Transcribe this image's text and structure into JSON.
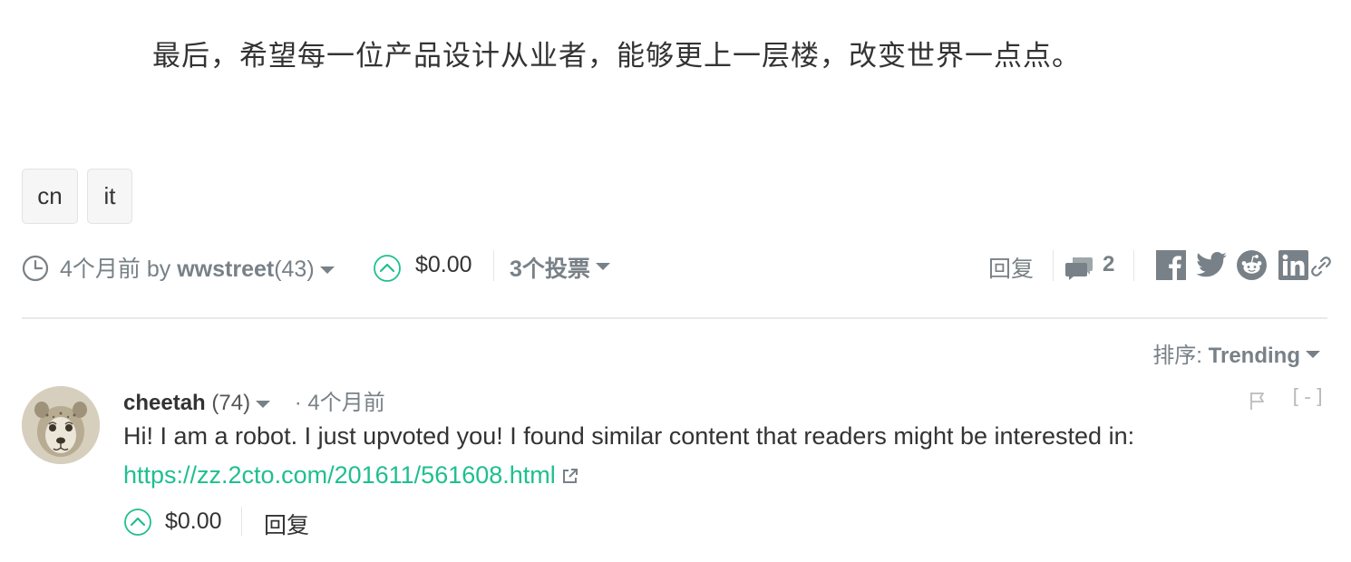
{
  "post": {
    "final_paragraph": "最后，希望每一位产品设计从业者，能够更上一层楼，改变世界一点点。",
    "tags": [
      "cn",
      "it"
    ]
  },
  "post_meta": {
    "age": "4个月前",
    "by": "by",
    "author": "wwstreet",
    "reputation": "(43)",
    "payout": "$0.00",
    "votes": "3个投票",
    "reply": "回复",
    "comment_count": "2",
    "icons": [
      "clock-icon",
      "upvote-icon",
      "comments-icon",
      "facebook-icon",
      "twitter-icon",
      "reddit-icon",
      "linkedin-icon",
      "link-icon"
    ]
  },
  "sort": {
    "label": "排序:",
    "value": "Trending"
  },
  "comment": {
    "author": "cheetah",
    "reputation": "(74)",
    "time": "· 4个月前",
    "body": "Hi! I am a robot. I just upvoted you! I found similar content that readers might be interested in:",
    "link": "https://zz.2cto.com/201611/561608.html",
    "payout": "$0.00",
    "reply": "回复",
    "collapse": "[-]"
  },
  "colors": {
    "accent": "#1fbf8f",
    "muted": "#788187",
    "text": "#333333"
  }
}
